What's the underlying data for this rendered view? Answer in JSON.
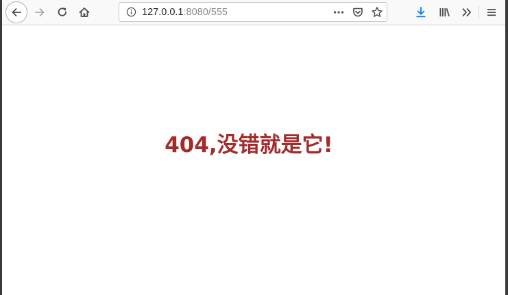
{
  "browser": {
    "toolbar": {
      "back_icon": "arrow-left-icon",
      "forward_icon": "arrow-right-icon",
      "reload_icon": "reload-icon",
      "home_icon": "home-icon"
    },
    "urlbar": {
      "host": "127.0.0.1",
      "port_path": ":8080/555",
      "info_icon": "info-icon",
      "actions": [
        "more-dots-icon",
        "pocket-icon",
        "star-icon"
      ]
    },
    "right_tools": [
      "download-icon",
      "library-icon",
      "overflow-chevron-icon",
      "hamburger-menu-icon"
    ],
    "colors": {
      "download_accent": "#0a84ff",
      "icon": "#4a4a4f",
      "disabled_icon": "#a7a7a9"
    }
  },
  "page": {
    "heading": "404,没错就是它!",
    "heading_color": "#a52a2a"
  }
}
